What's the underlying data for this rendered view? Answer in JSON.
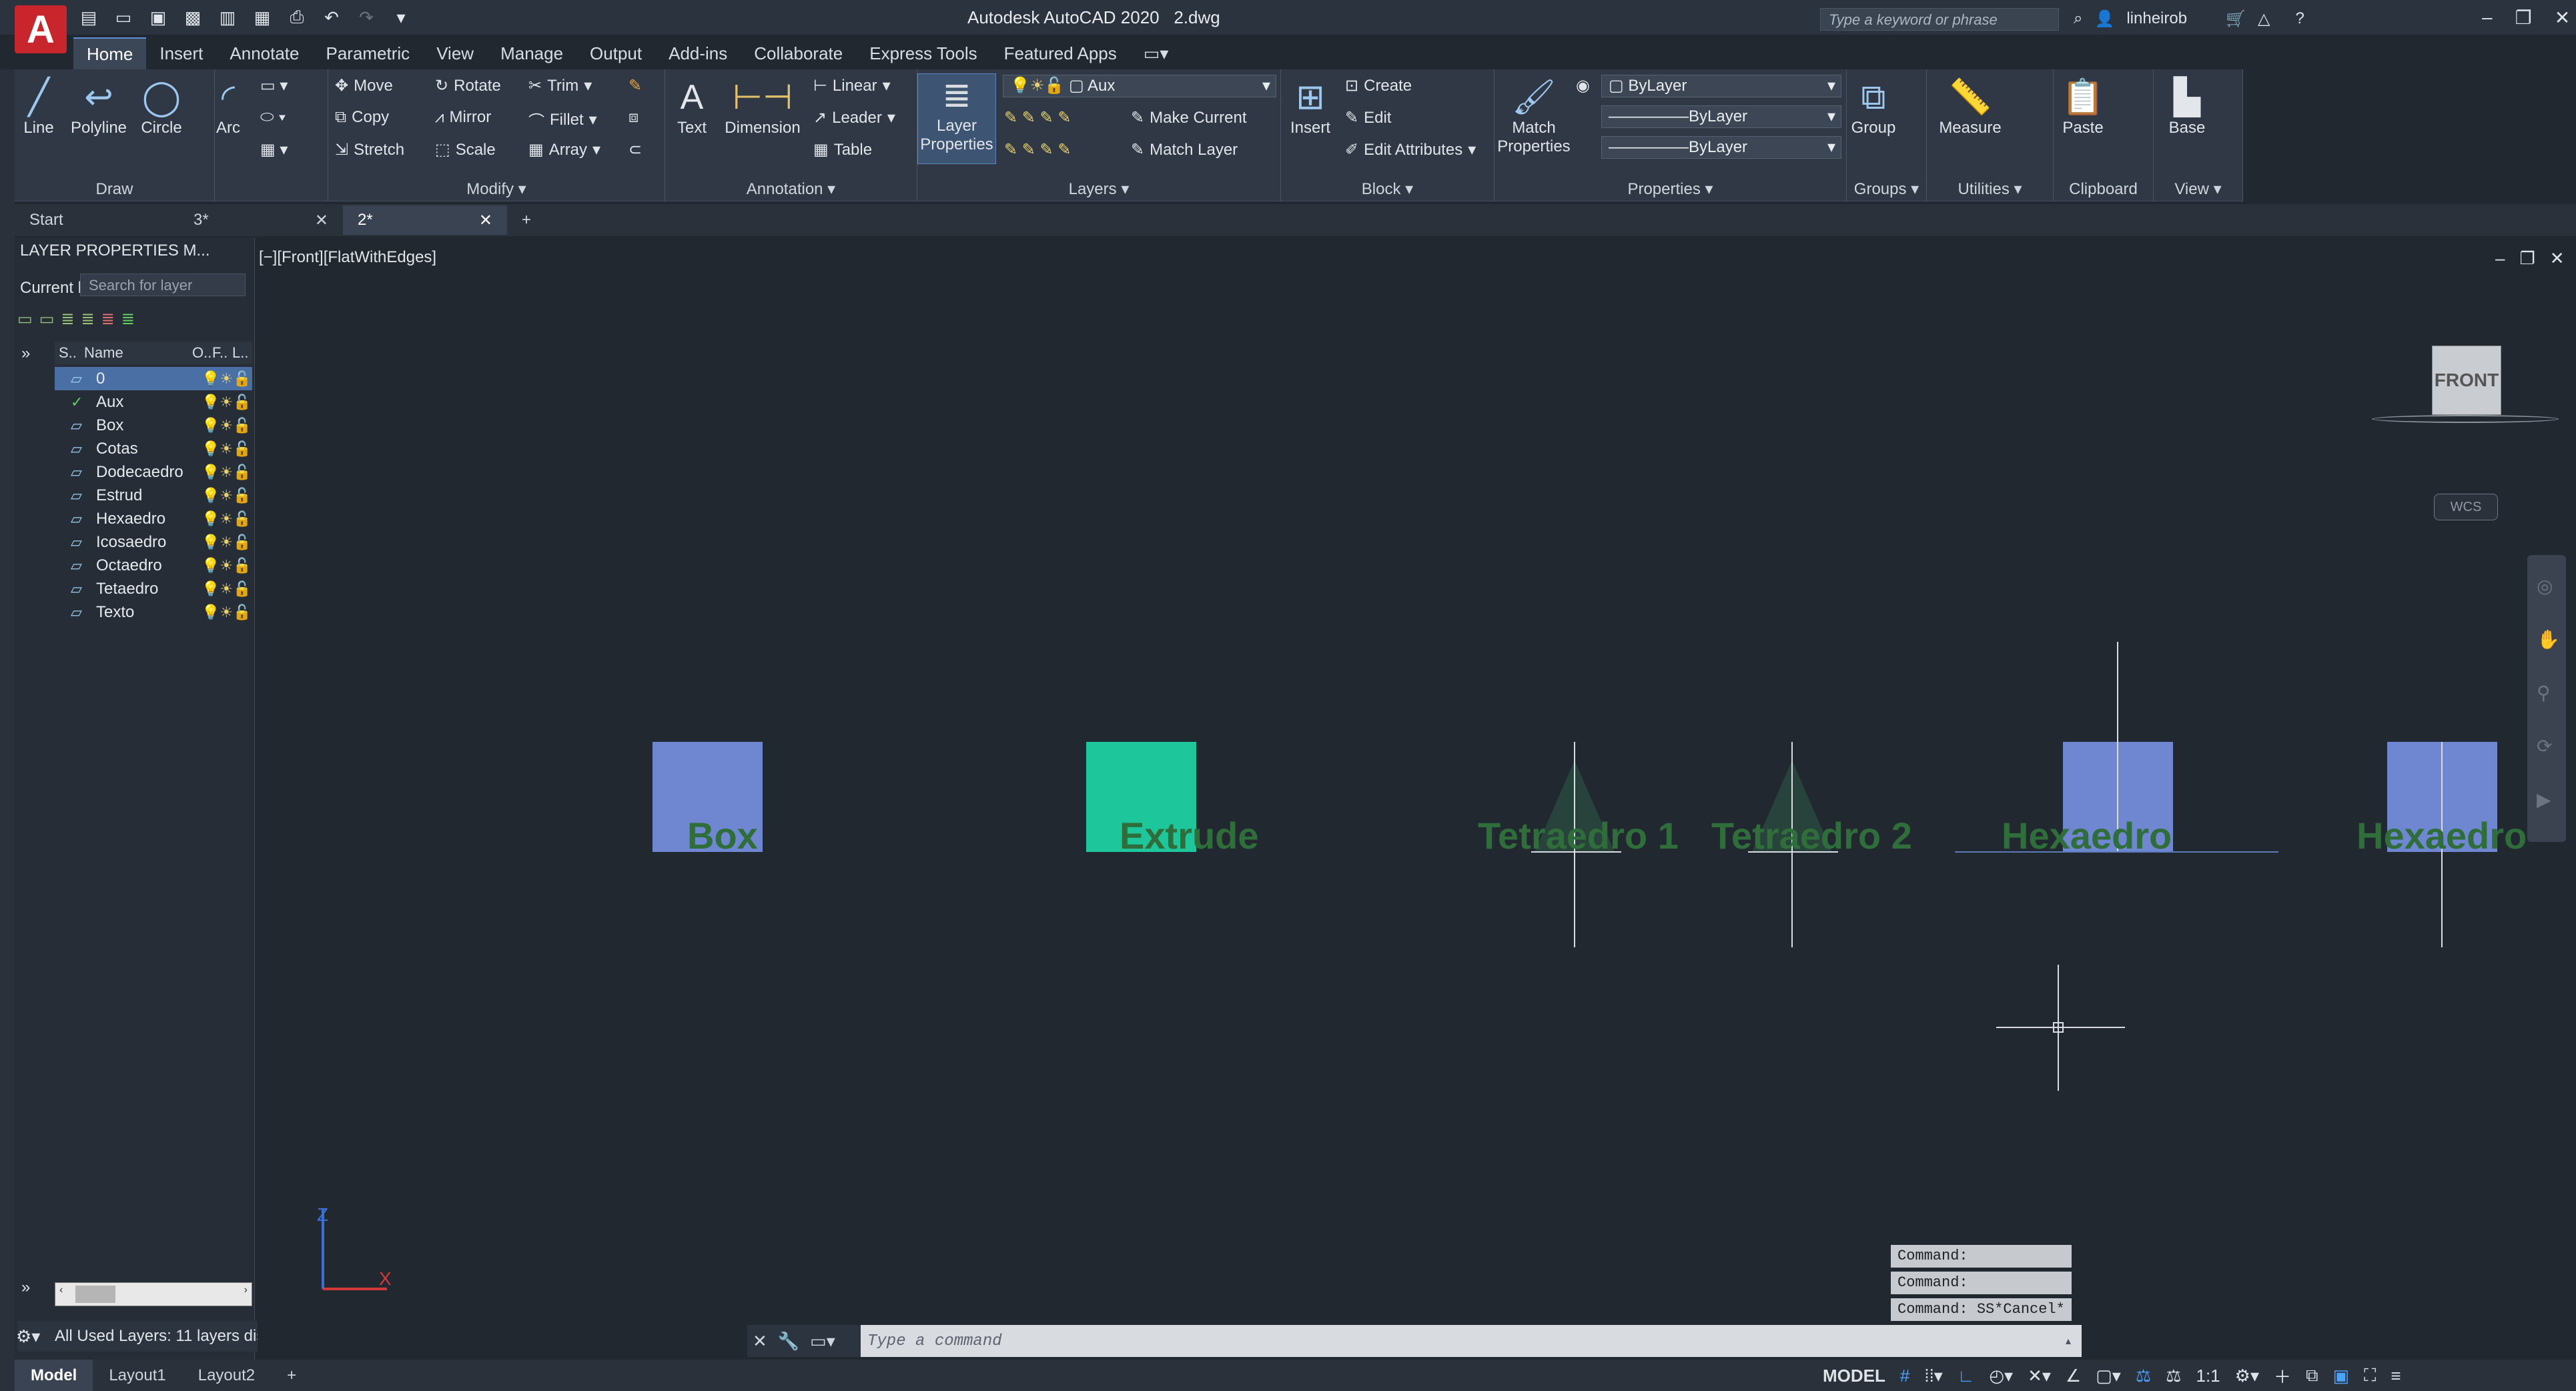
{
  "app": {
    "title": "Autodesk AutoCAD 2020",
    "filename": "2.dwg",
    "logo": "A"
  },
  "search": {
    "placeholder": "Type a keyword or phrase"
  },
  "user": {
    "name": "linheirob"
  },
  "menu": [
    "Home",
    "Insert",
    "Annotate",
    "Parametric",
    "View",
    "Manage",
    "Output",
    "Add-ins",
    "Collaborate",
    "Express Tools",
    "Featured Apps"
  ],
  "ribbon": {
    "draw": {
      "title": "Draw",
      "line": "Line",
      "polyline": "Polyline",
      "circle": "Circle",
      "arc": "Arc"
    },
    "modify": {
      "title": "Modify",
      "move": "Move",
      "rotate": "Rotate",
      "trim": "Trim",
      "copy": "Copy",
      "mirror": "Mirror",
      "fillet": "Fillet",
      "stretch": "Stretch",
      "scale": "Scale",
      "array": "Array"
    },
    "annotation": {
      "title": "Annotation",
      "text": "Text",
      "dimension": "Dimension",
      "linear": "Linear",
      "leader": "Leader",
      "table": "Table"
    },
    "layers": {
      "title": "Layers",
      "layer_properties": "Layer Properties",
      "current_layer": "Aux",
      "make_current": "Make Current",
      "match_layer": "Match Layer"
    },
    "block": {
      "title": "Block",
      "insert": "Insert",
      "create": "Create",
      "edit": "Edit",
      "edit_attributes": "Edit Attributes"
    },
    "properties": {
      "title": "Properties",
      "match": "Match Properties",
      "color": "ByLayer",
      "linetype": "ByLayer",
      "lineweight": "ByLayer"
    },
    "groups": {
      "title": "Groups",
      "group": "Group"
    },
    "utilities": {
      "title": "Utilities",
      "measure": "Measure"
    },
    "clipboard": {
      "title": "Clipboard",
      "paste": "Paste"
    },
    "view": {
      "title": "View",
      "base": "Base"
    }
  },
  "file_tabs": [
    {
      "label": "Start"
    },
    {
      "label": "3*"
    },
    {
      "label": "2*"
    }
  ],
  "layer_palette": {
    "title": "LAYER PROPERTIES M...",
    "current_label": "Current l",
    "search_placeholder": "Search for layer",
    "col_status": "S..",
    "col_name": "Name",
    "col_on": "O..",
    "col_freeze": "F..",
    "col_lock": "L..",
    "layers": [
      "0",
      "Aux",
      "Box",
      "Cotas",
      "Dodecaedro",
      "Estrud",
      "Hexaedro",
      "Icosaedro",
      "Octaedro",
      "Tetaedro",
      "Texto"
    ],
    "status": "All Used Layers: 11 layers dis"
  },
  "viewport": {
    "label": "[−][Front][FlatWithEdges]",
    "viewcube": "FRONT",
    "wcs": "WCS"
  },
  "drawing_labels": [
    "Box",
    "Extrude",
    "Tetraedro 1",
    "Tetraedro 2",
    "Hexaedro",
    "Hexaedro"
  ],
  "command_history": [
    "Command:",
    "Command:",
    "Command: SS*Cancel*"
  ],
  "command": {
    "placeholder": "Type a command"
  },
  "layout_tabs": [
    "Model",
    "Layout1",
    "Layout2"
  ],
  "status": {
    "model": "MODEL",
    "scale": "1:1"
  },
  "colors": {
    "accent": "#4aa3ff",
    "background": "#212830",
    "ribbon": "#2f3844",
    "box_fill": "#6f86d0",
    "extrude_fill": "#1ec79b",
    "label_green": "#2f6e3a"
  }
}
